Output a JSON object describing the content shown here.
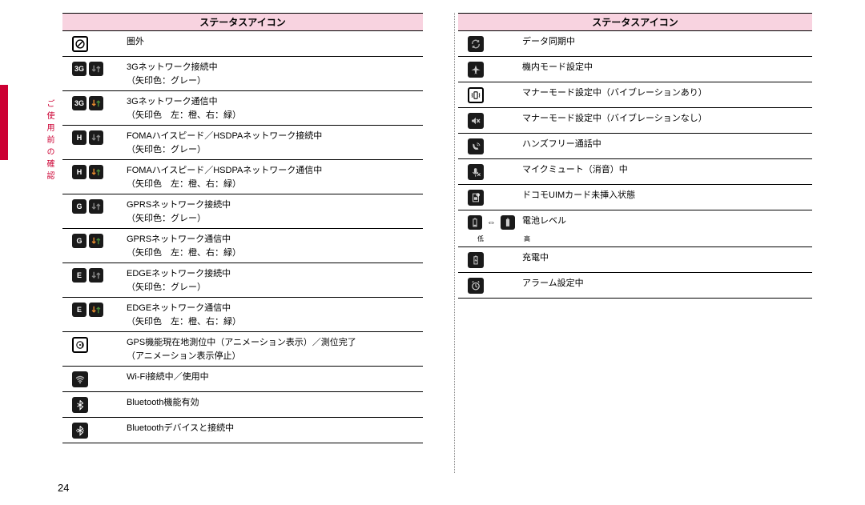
{
  "side_label": "ご使用前の確認",
  "page_number": "24",
  "left": {
    "header": "ステータスアイコン",
    "rows": [
      {
        "icon": "no-signal",
        "text": "圏外"
      },
      {
        "icon": "3g-pair",
        "text": "3Gネットワーク接続中\n（矢印色：グレー）"
      },
      {
        "icon": "3g-pair",
        "text": "3Gネットワーク通信中\n（矢印色　左：橙、右：緑）"
      },
      {
        "icon": "h-pair",
        "text": "FOMAハイスピード／HSDPAネットワーク接続中\n（矢印色：グレー）"
      },
      {
        "icon": "h-pair",
        "text": "FOMAハイスピード／HSDPAネットワーク通信中\n（矢印色　左：橙、右：緑）"
      },
      {
        "icon": "g-pair",
        "text": "GPRSネットワーク接続中\n（矢印色：グレー）"
      },
      {
        "icon": "g-pair",
        "text": "GPRSネットワーク通信中\n（矢印色　左：橙、右：緑）"
      },
      {
        "icon": "e-pair",
        "text": "EDGEネットワーク接続中\n（矢印色：グレー）"
      },
      {
        "icon": "e-pair",
        "text": "EDGEネットワーク通信中\n（矢印色　左：橙、右：緑）"
      },
      {
        "icon": "gps",
        "text": "GPS機能現在地測位中（アニメーション表示）／測位完了\n（アニメーション表示停止）"
      },
      {
        "icon": "wifi",
        "text": "Wi-Fi接続中／使用中"
      },
      {
        "icon": "bluetooth",
        "text": "Bluetooth機能有効"
      },
      {
        "icon": "bluetooth-conn",
        "text": "Bluetoothデバイスと接続中"
      }
    ]
  },
  "right": {
    "header": "ステータスアイコン",
    "rows": [
      {
        "icon": "sync",
        "text": "データ同期中"
      },
      {
        "icon": "airplane",
        "text": "機内モード設定中"
      },
      {
        "icon": "vibrate",
        "text": "マナーモード設定中（バイブレーションあり）"
      },
      {
        "icon": "silent",
        "text": "マナーモード設定中（バイブレーションなし）"
      },
      {
        "icon": "handsfree",
        "text": "ハンズフリー通話中"
      },
      {
        "icon": "mic-mute",
        "text": "マイクミュート（消音）中"
      },
      {
        "icon": "uim",
        "text": "ドコモUIMカード未挿入状態"
      },
      {
        "icon": "battery-level",
        "text": "電池レベル",
        "sub_low": "低",
        "sub_high": "高"
      },
      {
        "icon": "charging",
        "text": "充電中"
      },
      {
        "icon": "alarm",
        "text": "アラーム設定中"
      }
    ]
  }
}
